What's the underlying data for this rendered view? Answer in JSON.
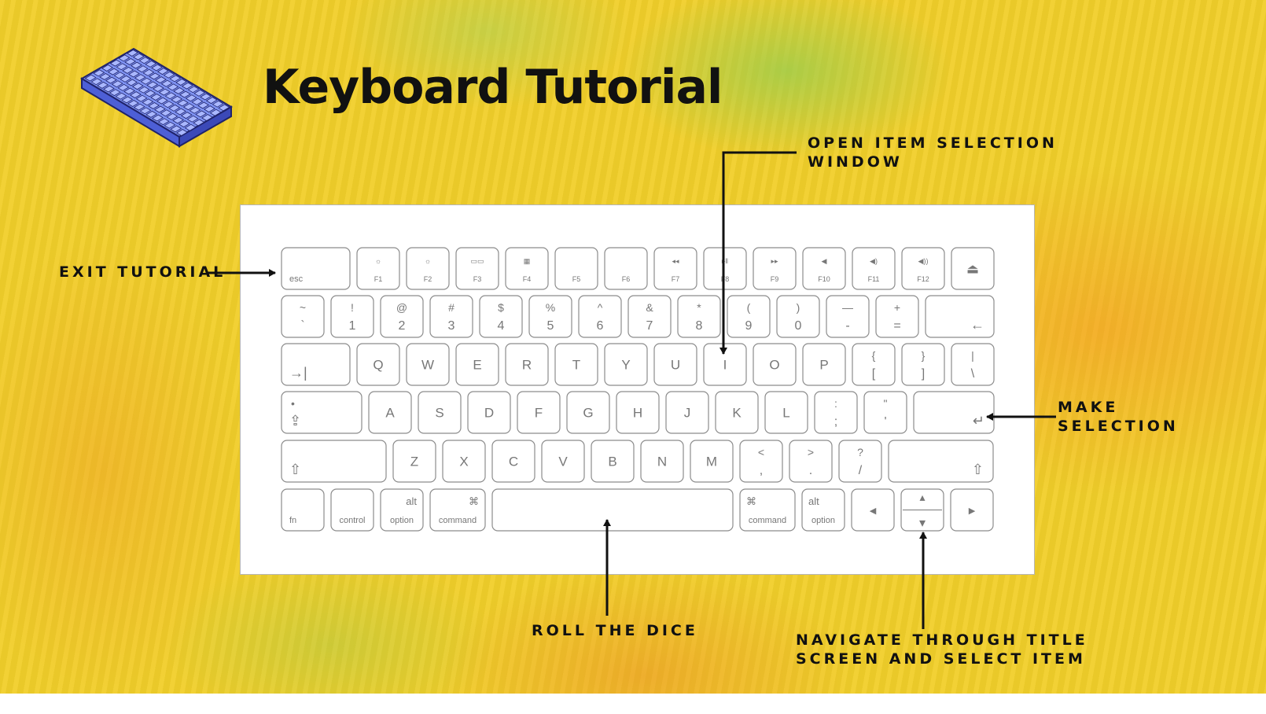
{
  "title": "Keyboard Tutorial",
  "labels": {
    "exit": "EXIT TUTORIAL",
    "open_item_line1": "OPEN ITEM SELECTION",
    "open_item_line2": "WINDOW",
    "make_selection_line1": "MAKE",
    "make_selection_line2": "SELECTION",
    "roll_dice": "ROLL THE DICE",
    "navigate_line1": "NAVIGATE THROUGH TITLE",
    "navigate_line2": "SCREEN AND SELECT ITEM"
  },
  "keyboard": {
    "rows": [
      [
        {
          "name": "esc",
          "bottom": "esc",
          "align": "left",
          "small": true
        },
        {
          "name": "f1",
          "top": "☼",
          "bottom": "F1",
          "small": true
        },
        {
          "name": "f2",
          "top": "☼",
          "bottom": "F2",
          "small": true
        },
        {
          "name": "f3",
          "top": "▭▭",
          "bottom": "F3",
          "small": true
        },
        {
          "name": "f4",
          "top": "▦",
          "bottom": "F4",
          "small": true
        },
        {
          "name": "f5",
          "bottom": "F5",
          "small": true
        },
        {
          "name": "f6",
          "bottom": "F6",
          "small": true
        },
        {
          "name": "f7",
          "top": "◂◂",
          "bottom": "F7",
          "small": true
        },
        {
          "name": "f8",
          "top": "▸‖",
          "bottom": "F8",
          "small": true
        },
        {
          "name": "f9",
          "top": "▸▸",
          "bottom": "F9",
          "small": true
        },
        {
          "name": "f10",
          "top": "◀",
          "bottom": "F10",
          "small": true
        },
        {
          "name": "f11",
          "top": "◀)",
          "bottom": "F11",
          "small": true
        },
        {
          "name": "f12",
          "top": "◀))",
          "bottom": "F12",
          "small": true
        },
        {
          "name": "eject",
          "center": "⏏"
        }
      ],
      [
        {
          "name": "tilde",
          "top": "~",
          "bottom": "`"
        },
        {
          "name": "1",
          "top": "!",
          "bottom": "1"
        },
        {
          "name": "2",
          "top": "@",
          "bottom": "2"
        },
        {
          "name": "3",
          "top": "#",
          "bottom": "3"
        },
        {
          "name": "4",
          "top": "$",
          "bottom": "4"
        },
        {
          "name": "5",
          "top": "%",
          "bottom": "5"
        },
        {
          "name": "6",
          "top": "^",
          "bottom": "6"
        },
        {
          "name": "7",
          "top": "&",
          "bottom": "7"
        },
        {
          "name": "8",
          "top": "*",
          "bottom": "8"
        },
        {
          "name": "9",
          "top": "(",
          "bottom": "9"
        },
        {
          "name": "0",
          "top": ")",
          "bottom": "0"
        },
        {
          "name": "minus",
          "top": "—",
          "bottom": "-"
        },
        {
          "name": "equals",
          "top": "+",
          "bottom": "="
        },
        {
          "name": "delete",
          "bottom": "←",
          "align": "right"
        }
      ],
      [
        {
          "name": "tab",
          "bottom": "→|",
          "align": "left"
        },
        {
          "name": "q",
          "center": "Q"
        },
        {
          "name": "w",
          "center": "W"
        },
        {
          "name": "e",
          "center": "E"
        },
        {
          "name": "r",
          "center": "R"
        },
        {
          "name": "t",
          "center": "T"
        },
        {
          "name": "y",
          "center": "Y"
        },
        {
          "name": "u",
          "center": "U"
        },
        {
          "name": "i",
          "center": "I"
        },
        {
          "name": "o",
          "center": "O"
        },
        {
          "name": "p",
          "center": "P"
        },
        {
          "name": "lbracket",
          "top": "{",
          "bottom": "["
        },
        {
          "name": "rbracket",
          "top": "}",
          "bottom": "]"
        },
        {
          "name": "backslash",
          "top": "|",
          "bottom": "\\"
        }
      ],
      [
        {
          "name": "caps",
          "top": "•",
          "bottom": "⇪",
          "align": "left"
        },
        {
          "name": "a",
          "center": "A"
        },
        {
          "name": "s",
          "center": "S"
        },
        {
          "name": "d",
          "center": "D"
        },
        {
          "name": "f",
          "center": "F"
        },
        {
          "name": "g",
          "center": "G"
        },
        {
          "name": "h",
          "center": "H"
        },
        {
          "name": "j",
          "center": "J"
        },
        {
          "name": "k",
          "center": "K"
        },
        {
          "name": "l",
          "center": "L"
        },
        {
          "name": "semicolon",
          "top": ":",
          "bottom": ";"
        },
        {
          "name": "quote",
          "top": "\"",
          "bottom": "'"
        },
        {
          "name": "return",
          "bottom": "↵",
          "align": "right"
        }
      ],
      [
        {
          "name": "lshift",
          "bottom": "⇧",
          "align": "left"
        },
        {
          "name": "z",
          "center": "Z"
        },
        {
          "name": "x",
          "center": "X"
        },
        {
          "name": "c",
          "center": "C"
        },
        {
          "name": "v",
          "center": "V"
        },
        {
          "name": "b",
          "center": "B"
        },
        {
          "name": "n",
          "center": "N"
        },
        {
          "name": "m",
          "center": "M"
        },
        {
          "name": "comma",
          "top": "<",
          "bottom": ","
        },
        {
          "name": "period",
          "top": ">",
          "bottom": "."
        },
        {
          "name": "slash",
          "top": "?",
          "bottom": "/"
        },
        {
          "name": "rshift",
          "bottom": "⇧",
          "align": "right"
        }
      ],
      [
        {
          "name": "fn",
          "bottom": "fn",
          "align": "left",
          "small": true
        },
        {
          "name": "control",
          "bottom": "control",
          "small": true
        },
        {
          "name": "loption",
          "top": "alt",
          "bottom": "option",
          "small": true,
          "topalign": "right"
        },
        {
          "name": "lcommand",
          "top": "⌘",
          "bottom": "command",
          "small": true,
          "topalign": "right"
        },
        {
          "name": "space"
        },
        {
          "name": "rcommand",
          "top": "⌘",
          "bottom": "command",
          "small": true,
          "topalign": "left"
        },
        {
          "name": "roption",
          "top": "alt",
          "bottom": "option",
          "small": true,
          "topalign": "left"
        },
        {
          "name": "left",
          "center": "◂"
        },
        {
          "name": "updown",
          "top": "▴",
          "bottom": "▾",
          "split": true
        },
        {
          "name": "right",
          "center": "▸"
        }
      ]
    ]
  }
}
